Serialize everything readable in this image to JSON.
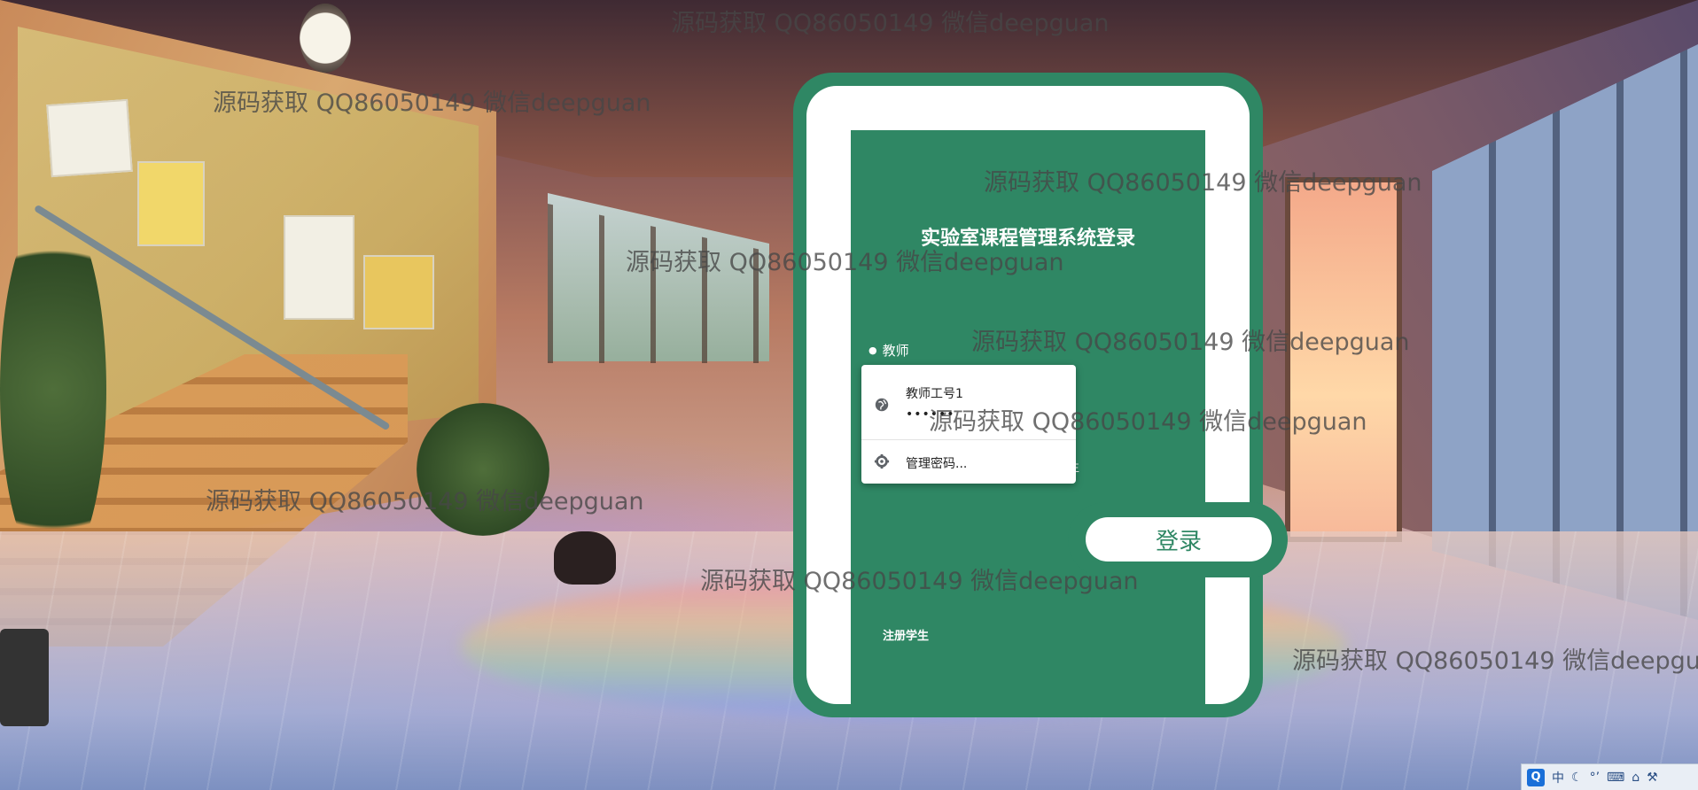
{
  "app": {
    "title": "实验室课程管理系统登录"
  },
  "login": {
    "role_label": "教师",
    "obscured_text": "生",
    "register_label": "注册学生",
    "login_label": "登录"
  },
  "autofill": {
    "username": "教师工号1",
    "password_mask": "••••••",
    "manage_label": "管理密码..."
  },
  "watermark": {
    "text": "源码获取 QQ86050149 微信deepguan"
  },
  "tray": {
    "ime_label": "中",
    "icons": [
      "qq-icon",
      "ime-chinese-icon",
      "moon-icon",
      "punctuation-icon",
      "keyboard-icon",
      "settings-icon",
      "wrench-icon"
    ]
  },
  "colors": {
    "accent": "#2f8764",
    "card_white": "#ffffff"
  }
}
